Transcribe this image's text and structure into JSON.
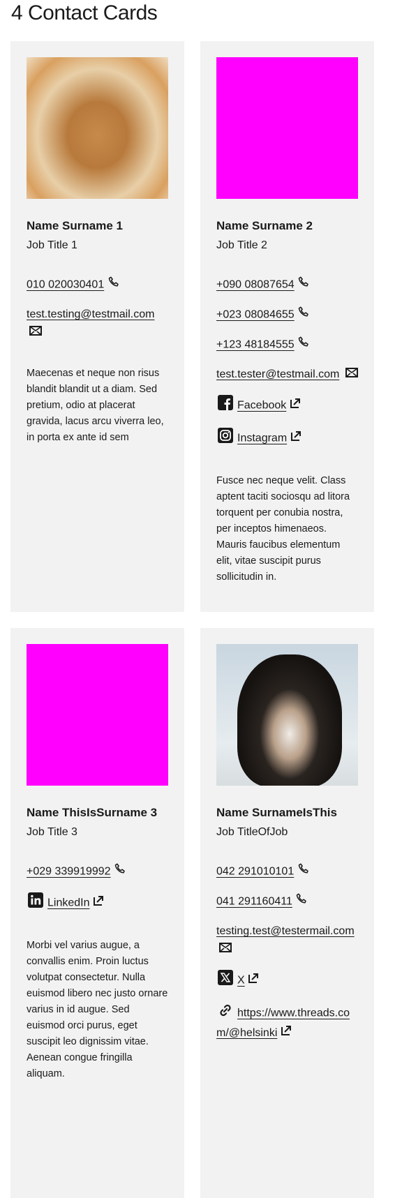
{
  "title": "4 Contact Cards",
  "cards": [
    {
      "image": "lion",
      "name": "Name Surname 1",
      "job": "Job Title 1",
      "phones": [
        "010 020030401"
      ],
      "email": "test.testing@testmail.com",
      "links": [],
      "description": "Maecenas et neque non risus blandit blandit ut a diam. Sed pretium, odio at placerat gravida, lacus arcu viverra leo, in porta ex ante id sem"
    },
    {
      "image": "placeholder-magenta",
      "name": "Name Surname 2",
      "job": "Job Title 2",
      "phones": [
        "+090 08087654",
        "+023 08084655",
        "+123 48184555"
      ],
      "email": "test.tester@testmail.com",
      "links": [
        {
          "label": "Facebook",
          "icon": "facebook-icon"
        },
        {
          "label": "Instagram",
          "icon": "instagram-icon"
        }
      ],
      "description": "Fusce nec neque velit. Class aptent taciti sociosqu ad litora torquent per conubia nostra, per inceptos himenaeos. Mauris faucibus elementum elit, vitae suscipit purus sollicitudin in."
    },
    {
      "image": "placeholder-magenta",
      "name": "Name ThisIsSurname 3",
      "job": "Job Title 3",
      "phones": [
        "+029 339919992"
      ],
      "email": "",
      "links": [
        {
          "label": "LinkedIn",
          "icon": "linkedin-icon"
        }
      ],
      "description": "Morbi vel varius augue, a convallis enim. Proin luctus volutpat consectetur. Nulla euismod libero nec justo ornare varius in id augue. Sed euismod orci purus, eget suscipit leo dignissim vitae. Aenean congue fringilla aliquam."
    },
    {
      "image": "husky",
      "name": "Name SurnameIsThis",
      "job": "Job TitleOfJob",
      "phones": [
        "042 291010101",
        "041 291160411"
      ],
      "email": "testing.test@testermail.com",
      "links": [
        {
          "label": "X",
          "icon": "x-icon"
        },
        {
          "label": "https://www.threads.com/@helsinki",
          "icon": "link-icon"
        }
      ],
      "description": ""
    }
  ],
  "colors": {
    "card_bg": "#f2f2f2",
    "placeholder": "#ff00ff",
    "text": "#1a1a1a"
  }
}
